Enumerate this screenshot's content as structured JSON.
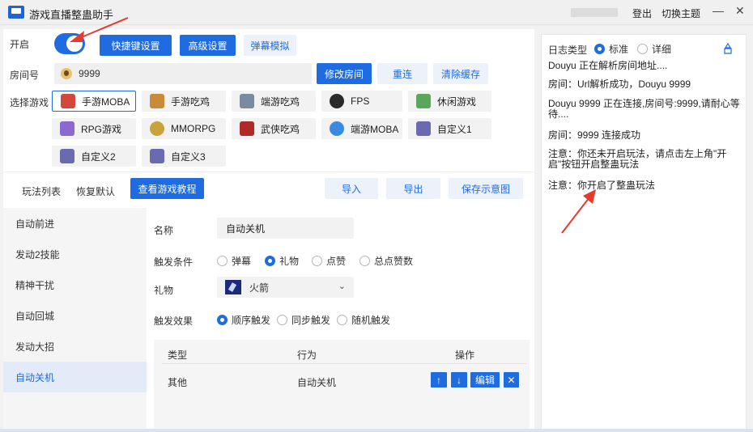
{
  "window": {
    "title": "游戏直播整蛊助手",
    "login": "登出",
    "switch_theme": "切换主题",
    "minimize": "—",
    "close": "✕"
  },
  "top": {
    "enable_label": "开启",
    "toggle_on": true,
    "shortcut_btn": "快捷键设置",
    "advanced_btn": "高级设置",
    "danmu_btn": "弹幕模拟",
    "room_label": "房间号",
    "room_value": "9999",
    "modify_room_btn": "修改房间",
    "reconnect_btn": "重连",
    "clear_cache_btn": "清除缓存",
    "game_label": "选择游戏"
  },
  "games": [
    {
      "label": "手游MOBA",
      "color": "#d2483a",
      "selected": true
    },
    {
      "label": "手游吃鸡",
      "color": "#c98a3a"
    },
    {
      "label": "端游吃鸡",
      "color": "#7a8aa0"
    },
    {
      "label": "FPS",
      "color": "#2a2a2a"
    },
    {
      "label": "休闲游戏",
      "color": "#5aa65a"
    },
    {
      "label": "RPG游戏",
      "color": "#8a6ad0"
    },
    {
      "label": "MMORPG",
      "color": "#c9a23a"
    },
    {
      "label": "武侠吃鸡",
      "color": "#b02a2a"
    },
    {
      "label": "端游MOBA",
      "color": "#3a8ae0"
    },
    {
      "label": "自定义1",
      "color": "#6a6ab0"
    },
    {
      "label": "自定义2",
      "color": "#6a6ab0"
    },
    {
      "label": "自定义3",
      "color": "#6a6ab0"
    }
  ],
  "toolbar": {
    "play_list": "玩法列表",
    "restore_default": "恢复默认",
    "view_tutorial": "查看游戏教程",
    "import": "导入",
    "export": "导出",
    "save_diagram": "保存示意图"
  },
  "plays": [
    {
      "label": "自动前进"
    },
    {
      "label": "发动2技能"
    },
    {
      "label": "精神干扰"
    },
    {
      "label": "自动回城"
    },
    {
      "label": "发动大招"
    },
    {
      "label": "自动关机",
      "active": true
    }
  ],
  "detail": {
    "name_label": "名称",
    "name_value": "自动关机",
    "trigger_label": "触发条件",
    "trigger_options": [
      "弹幕",
      "礼物",
      "点赞",
      "总点赞数"
    ],
    "trigger_selected": "礼物",
    "gift_label": "礼物",
    "gift_value": "火箭",
    "effect_label": "触发效果",
    "effect_options": [
      "顺序触发",
      "同步触发",
      "随机触发"
    ],
    "effect_selected": "顺序触发"
  },
  "table": {
    "headers": [
      "类型",
      "行为",
      "操作"
    ],
    "rows": [
      {
        "type": "其他",
        "action": "自动关机"
      }
    ],
    "op_up": "↑",
    "op_down": "↓",
    "op_edit": "编辑",
    "op_delete": "✕"
  },
  "log": {
    "type_label": "日志类型",
    "options": [
      "标准",
      "详细"
    ],
    "selected": "标准",
    "lines": [
      "Douyu   正在解析房间地址....",
      "房间：Url解析成功，Douyu 9999",
      "Douyu  9999 正在连接,房间号:9999,请耐心等待....",
      "房间：9999 连接成功",
      "注意：你还未开启玩法，请点击左上角\"开启\"按钮开启整蛊玩法",
      "注意：你开启了整蛊玩法"
    ]
  },
  "colors": {
    "accent": "#1f6be0",
    "arrow": "#e8392c"
  }
}
